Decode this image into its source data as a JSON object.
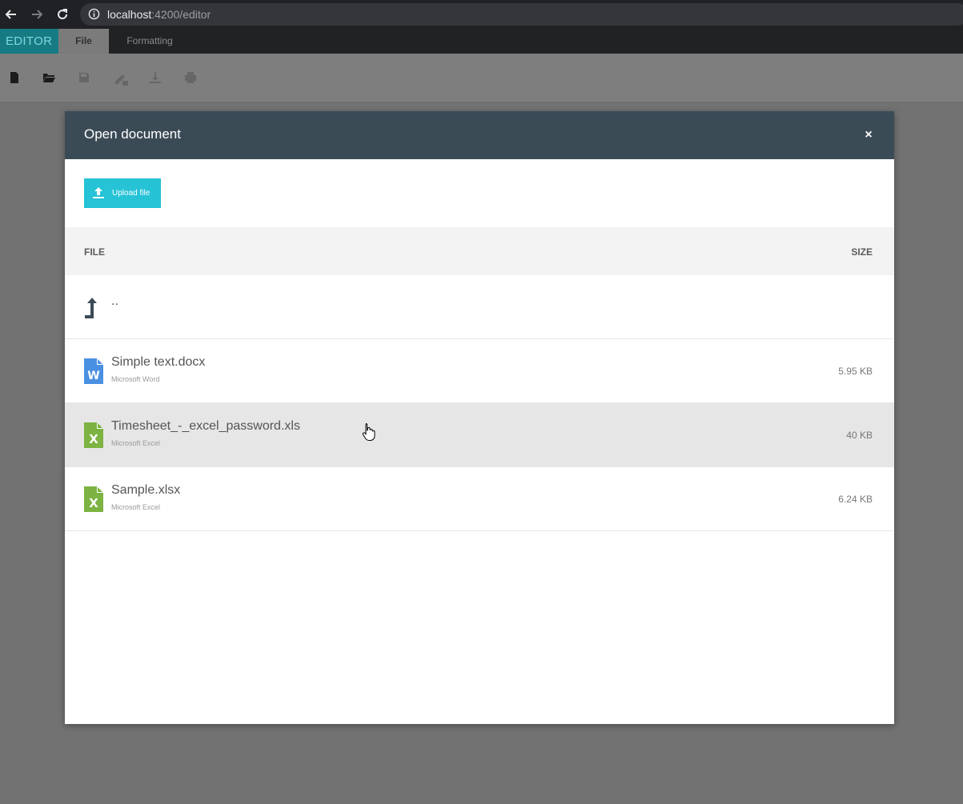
{
  "browser": {
    "url_host": "localhost",
    "url_path": ":4200/editor"
  },
  "app": {
    "brand": "EDITOR",
    "tabs": [
      {
        "label": "File",
        "active": true
      },
      {
        "label": "Formatting",
        "active": false
      }
    ],
    "toolbar_icons": [
      "new-document-icon",
      "open-folder-icon",
      "save-icon",
      "rename-icon",
      "download-icon",
      "print-icon"
    ]
  },
  "dialog": {
    "title": "Open document",
    "close_glyph": "×",
    "upload_label": "Upload file",
    "columns": {
      "file": "FILE",
      "size": "SIZE"
    },
    "parent_dir": "..",
    "files": [
      {
        "name": "Simple text.docx",
        "type": "Microsoft Word",
        "size": "5.95 KB",
        "icon": "word-file-icon",
        "icon_color": "#4a90e2",
        "letter": "W"
      },
      {
        "name": "Timesheet_-_excel_password.xls",
        "type": "Microsoft Excel",
        "size": "40 KB",
        "icon": "excel-file-icon",
        "icon_color": "#7cb342",
        "letter": "X"
      },
      {
        "name": "Sample.xlsx",
        "type": "Microsoft Excel",
        "size": "6.24 KB",
        "icon": "excel-file-icon",
        "icon_color": "#7cb342",
        "letter": "X"
      }
    ]
  },
  "colors": {
    "header_bg": "#3b4b56",
    "upload_bg": "#26c2d6",
    "brand_bg": "#167b83"
  }
}
